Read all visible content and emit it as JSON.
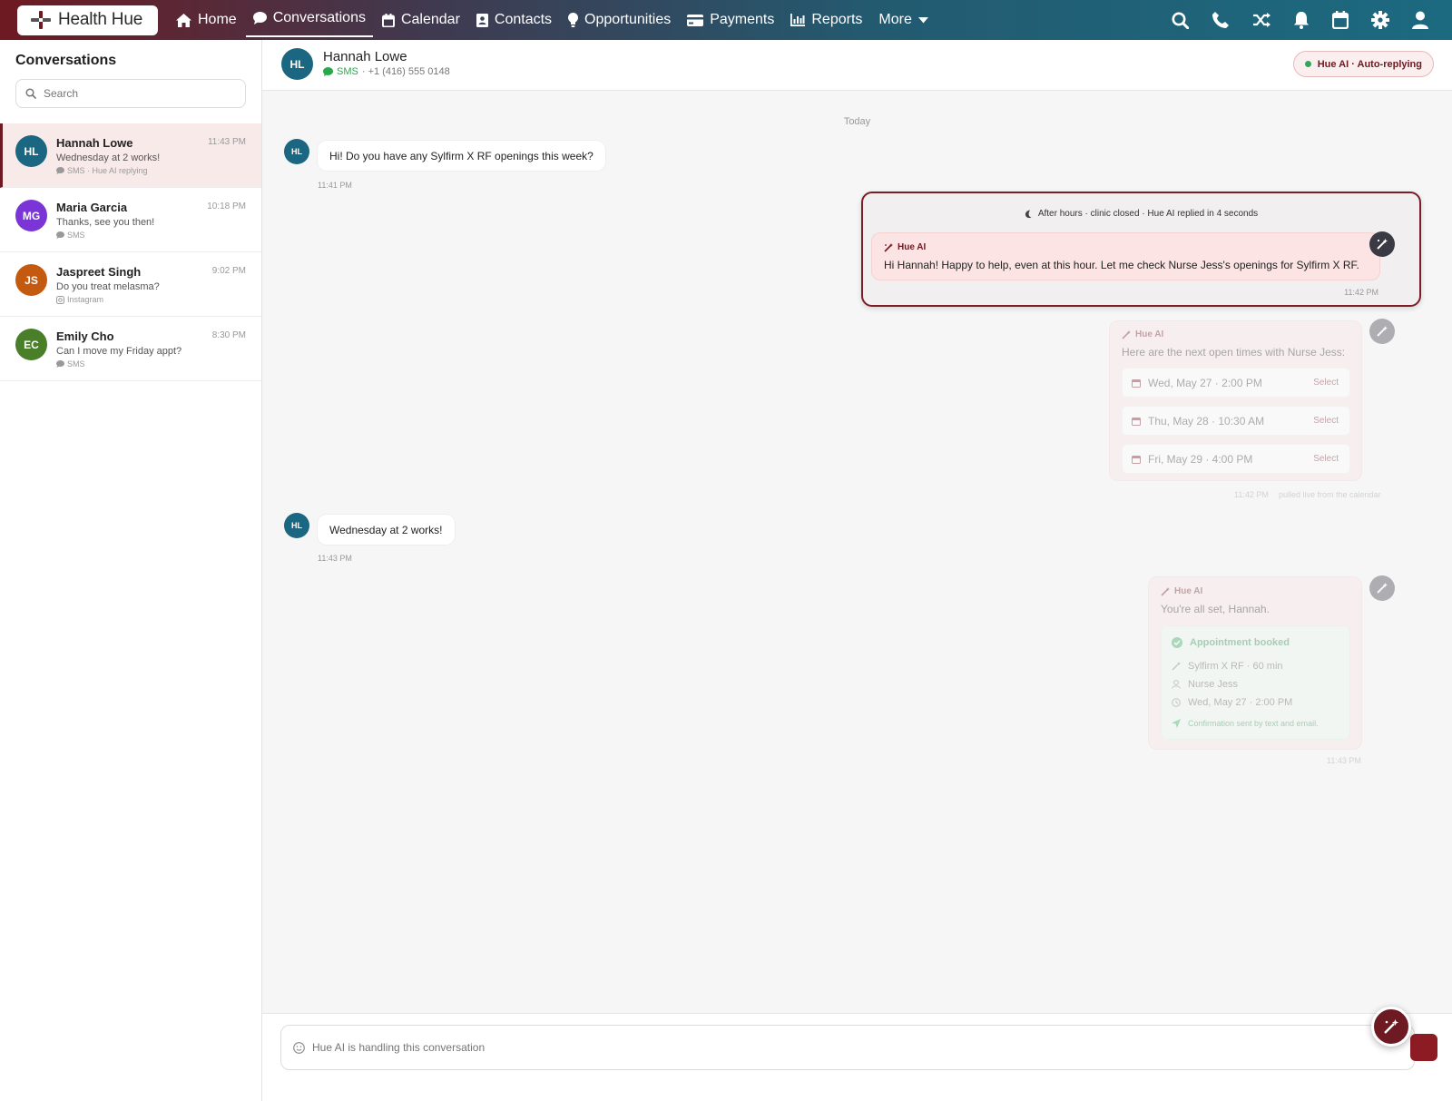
{
  "brand": {
    "name": "Health Hue"
  },
  "nav": {
    "items": [
      {
        "label": "Home",
        "icon": "home-icon"
      },
      {
        "label": "Conversations",
        "icon": "chat-icon",
        "active": true
      },
      {
        "label": "Calendar",
        "icon": "calendar-icon"
      },
      {
        "label": "Contacts",
        "icon": "contacts-icon"
      },
      {
        "label": "Opportunities",
        "icon": "lightbulb-icon"
      },
      {
        "label": "Payments",
        "icon": "credit-card-icon"
      },
      {
        "label": "Reports",
        "icon": "bar-chart-icon"
      },
      {
        "label": "More",
        "icon": "chevron-down-icon"
      }
    ],
    "right_icons": [
      "search-icon",
      "phone-icon",
      "shuffle-icon",
      "bell-icon",
      "calendar-icon",
      "gear-icon",
      "user-icon"
    ]
  },
  "sidebar": {
    "title": "Conversations",
    "search_placeholder": "Search",
    "conversations": [
      {
        "initials": "HL",
        "name": "Hannah Lowe",
        "time": "11:43 PM",
        "preview": "Wednesday at 2 works!",
        "meta": "SMS · Hue AI replying",
        "color": "#1b6680",
        "active": true
      },
      {
        "initials": "MG",
        "name": "Maria Garcia",
        "time": "10:18 PM",
        "preview": "Thanks, see you then!",
        "meta": "SMS",
        "color": "#7b35d6"
      },
      {
        "initials": "JS",
        "name": "Jaspreet Singh",
        "time": "9:02 PM",
        "preview": "Do you treat melasma?",
        "meta": "Instagram",
        "color": "#c45a10"
      },
      {
        "initials": "EC",
        "name": "Emily Cho",
        "time": "8:30 PM",
        "preview": "Can I move my Friday appt?",
        "meta": "SMS",
        "color": "#4a7f2a"
      }
    ]
  },
  "chat": {
    "contact": {
      "initials": "HL",
      "name": "Hannah Lowe",
      "channel": "SMS",
      "phone": "· +1 (416) 555 0148"
    },
    "status_pill": "Hue AI · Auto-replying",
    "date_separator": "Today",
    "msg1": {
      "text": "Hi! Do you have any Sylfirm X RF openings this week?",
      "time": "11:41 PM"
    },
    "after_hours_notice": "After hours · clinic closed · Hue AI replied in 4 seconds",
    "ai1": {
      "label": "Hue AI",
      "text": "Hi Hannah! Happy to help, even at this hour. Let me check Nurse Jess's openings for Sylfirm X RF.",
      "time": "11:42 PM"
    },
    "ai2": {
      "label": "Hue AI",
      "text": "Here are the next open times with Nurse Jess:",
      "slots": [
        {
          "label": "Wed, May 27 · 2:00 PM",
          "action": "Select"
        },
        {
          "label": "Thu, May 28 · 10:30 AM",
          "action": "Select"
        },
        {
          "label": "Fri, May 29 · 4:00 PM",
          "action": "Select"
        }
      ],
      "time": "11:42 PM",
      "note": "pulled live from the calendar"
    },
    "msg2": {
      "text": "Wednesday at 2 works!",
      "time": "11:43 PM"
    },
    "ai3": {
      "label": "Hue AI",
      "text": "You're all set, Hannah.",
      "card_title": "Appointment booked",
      "service": "Sylfirm X RF · 60 min",
      "provider": "Nurse Jess",
      "datetime": "Wed, May 27 · 2:00 PM",
      "confirmation": "Confirmation sent by text and email.",
      "time": "11:43 PM"
    }
  },
  "composer": {
    "placeholder": "Hue AI is handling this conversation"
  },
  "colors": {
    "accent": "#6e1a22",
    "teal": "#1b6680",
    "ai_bubble": "#fbe4e3",
    "sms_green": "#27a84a"
  }
}
